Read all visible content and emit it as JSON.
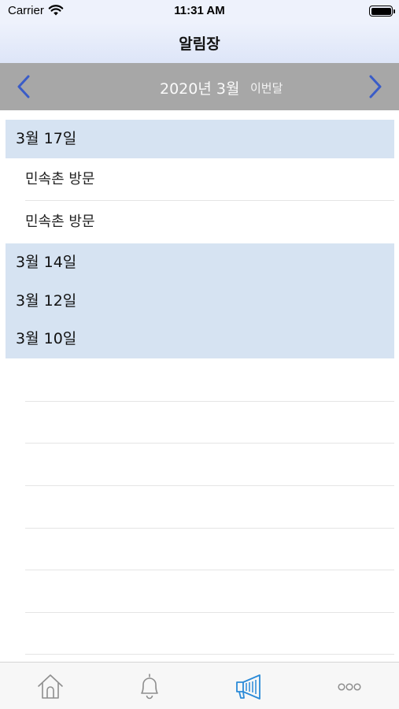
{
  "status_bar": {
    "carrier": "Carrier",
    "time": "11:31 AM"
  },
  "nav": {
    "title": "알림장"
  },
  "month_bar": {
    "month_label": "2020년 3월",
    "this_month_label": "이번달",
    "accent_color": "#3a5cc7"
  },
  "sections": [
    {
      "date": "3월 17일",
      "items": [
        "민속촌 방문",
        "민속촌 방문"
      ]
    },
    {
      "date": "3월 14일",
      "items": []
    },
    {
      "date": "3월 12일",
      "items": []
    },
    {
      "date": "3월 10일",
      "items": []
    }
  ],
  "tab_bar": {
    "tabs": [
      {
        "icon": "home-icon",
        "active": false
      },
      {
        "icon": "bell-icon",
        "active": false
      },
      {
        "icon": "megaphone-icon",
        "active": true
      },
      {
        "icon": "more-icon",
        "active": false
      }
    ],
    "active_color": "#2a8ad8",
    "inactive_color": "#8e8e8e"
  }
}
